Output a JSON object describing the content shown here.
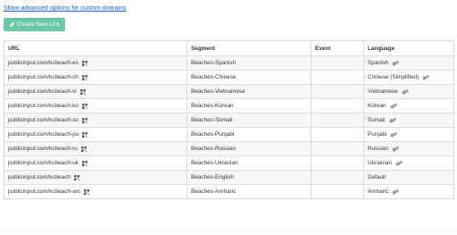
{
  "advanced_link": "Show advanced options for custom domains",
  "create_button": {
    "label": "Create New Link",
    "icon": "link-icon",
    "color": "#6cc7a4"
  },
  "table": {
    "headers": {
      "url": "URL",
      "segment": "Segment",
      "event": "Event",
      "language": "Language"
    },
    "rows": [
      {
        "url": "publicinput.com/kcbeach-es",
        "segment": "Beaches-Spanish",
        "event": "",
        "language": "Spanish",
        "gear": true
      },
      {
        "url": "publicinput.com/kcbeach-ch",
        "segment": "Beaches-Chinese",
        "event": "",
        "language": "Chinese (Simplified)",
        "gear": true
      },
      {
        "url": "publicinput.com/kcbeach-vi",
        "segment": "Beaches-Vietnamese",
        "event": "",
        "language": "Vietnamese",
        "gear": true
      },
      {
        "url": "publicinput.com/kcbeach-ko",
        "segment": "Beaches-Korean",
        "event": "",
        "language": "Korean",
        "gear": true
      },
      {
        "url": "publicinput.com/kcbeach-so",
        "segment": "Beaches-Somali",
        "event": "",
        "language": "Somali",
        "gear": true
      },
      {
        "url": "publicinput.com/kcbeach-pu",
        "segment": "Beaches-Punjabi",
        "event": "",
        "language": "Punjabi",
        "gear": true
      },
      {
        "url": "publicinput.com/kcbeach-ru",
        "segment": "Beaches-Russian",
        "event": "",
        "language": "Russian",
        "gear": true
      },
      {
        "url": "publicinput.com/kcbeach-uk",
        "segment": "Beaches-Ukranian",
        "event": "",
        "language": "Ukrainian",
        "gear": true
      },
      {
        "url": "publicinput.com/kcbeach",
        "segment": "Beaches-English",
        "event": "",
        "language": "Default",
        "gear": false
      },
      {
        "url": "publicinput.com/kcbeach-am",
        "segment": "Beaches-Amharic",
        "event": "",
        "language": "Amharic",
        "gear": true
      }
    ]
  }
}
